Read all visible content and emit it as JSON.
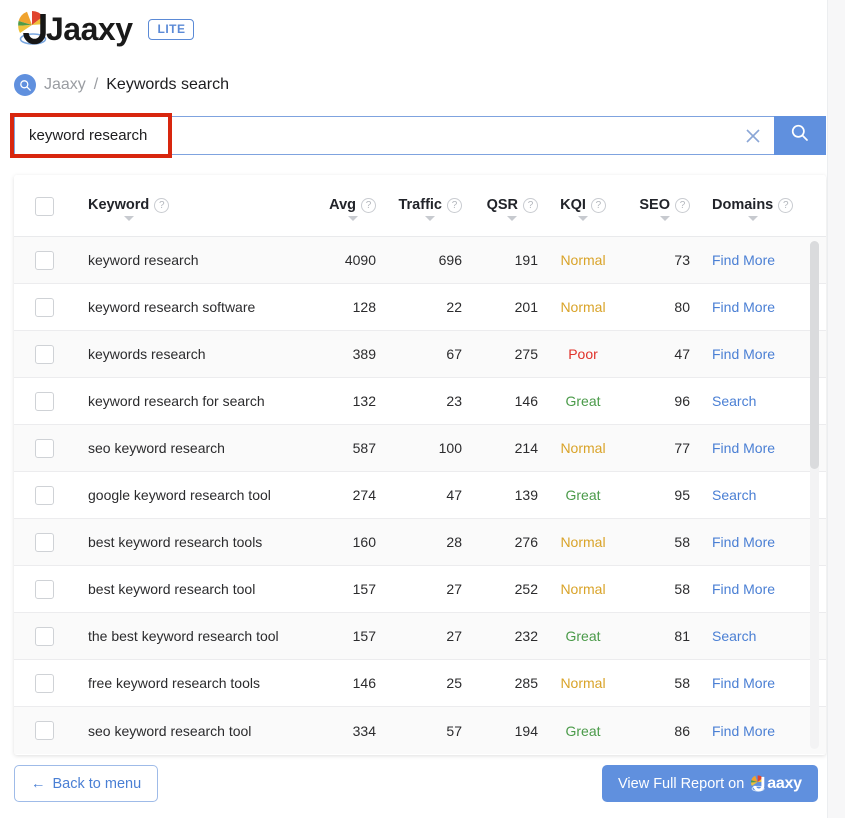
{
  "brand": {
    "name": "Jaaxy",
    "plan_badge": "LITE",
    "logo_icon": "jaaxy-pie-logo-icon",
    "accent_blue": "#6090de",
    "link_blue": "#4a7fd4",
    "annotation_red": "#d8260e"
  },
  "breadcrumb": {
    "icon": "search-badge-icon",
    "root": "Jaaxy",
    "separator": "/",
    "current": "Keywords search"
  },
  "search": {
    "value": "keyword research",
    "placeholder": "",
    "clear_icon": "close-x-icon",
    "submit_icon": "search-icon"
  },
  "table": {
    "select_all_label": "",
    "help_glyph": "?",
    "columns": [
      {
        "key": "keyword",
        "label": "Keyword",
        "help": "?",
        "sortable": true
      },
      {
        "key": "avg",
        "label": "Avg",
        "help": "?",
        "sortable": true
      },
      {
        "key": "traffic",
        "label": "Traffic",
        "help": "?",
        "sortable": true
      },
      {
        "key": "qsr",
        "label": "QSR",
        "help": "?",
        "sortable": true
      },
      {
        "key": "kqi",
        "label": "KQI",
        "help": "?",
        "sortable": true
      },
      {
        "key": "seo",
        "label": "SEO",
        "help": "?",
        "sortable": true
      },
      {
        "key": "domains",
        "label": "Domains",
        "help": "?",
        "sortable": true
      }
    ],
    "rows": [
      {
        "keyword": "keyword research",
        "avg": "4090",
        "traffic": "696",
        "qsr": "191",
        "kqi": "Normal",
        "kqi_state": "normal",
        "seo": "73",
        "domains": "Find More"
      },
      {
        "keyword": "keyword research software",
        "avg": "128",
        "traffic": "22",
        "qsr": "201",
        "kqi": "Normal",
        "kqi_state": "normal",
        "seo": "80",
        "domains": "Find More"
      },
      {
        "keyword": "keywords research",
        "avg": "389",
        "traffic": "67",
        "qsr": "275",
        "kqi": "Poor",
        "kqi_state": "poor",
        "seo": "47",
        "domains": "Find More"
      },
      {
        "keyword": "keyword research for search",
        "avg": "132",
        "traffic": "23",
        "qsr": "146",
        "kqi": "Great",
        "kqi_state": "great",
        "seo": "96",
        "domains": "Search"
      },
      {
        "keyword": "seo keyword research",
        "avg": "587",
        "traffic": "100",
        "qsr": "214",
        "kqi": "Normal",
        "kqi_state": "normal",
        "seo": "77",
        "domains": "Find More"
      },
      {
        "keyword": "google keyword research tool",
        "avg": "274",
        "traffic": "47",
        "qsr": "139",
        "kqi": "Great",
        "kqi_state": "great",
        "seo": "95",
        "domains": "Search"
      },
      {
        "keyword": "best keyword research tools",
        "avg": "160",
        "traffic": "28",
        "qsr": "276",
        "kqi": "Normal",
        "kqi_state": "normal",
        "seo": "58",
        "domains": "Find More"
      },
      {
        "keyword": "best keyword research tool",
        "avg": "157",
        "traffic": "27",
        "qsr": "252",
        "kqi": "Normal",
        "kqi_state": "normal",
        "seo": "58",
        "domains": "Find More"
      },
      {
        "keyword": "the best keyword research tool",
        "avg": "157",
        "traffic": "27",
        "qsr": "232",
        "kqi": "Great",
        "kqi_state": "great",
        "seo": "81",
        "domains": "Search"
      },
      {
        "keyword": "free keyword research tools",
        "avg": "146",
        "traffic": "25",
        "qsr": "285",
        "kqi": "Normal",
        "kqi_state": "normal",
        "seo": "58",
        "domains": "Find More"
      },
      {
        "keyword": "seo keyword research tool",
        "avg": "334",
        "traffic": "57",
        "qsr": "194",
        "kqi": "Great",
        "kqi_state": "great",
        "seo": "86",
        "domains": "Find More"
      }
    ],
    "kqi_colors": {
      "normal": "#d9a328",
      "poor": "#e0322a",
      "great": "#4a9a49"
    }
  },
  "footer": {
    "back_arrow": "←",
    "back_label": "Back to menu",
    "report_label": "View Full Report on",
    "report_brand": "aaxy"
  }
}
